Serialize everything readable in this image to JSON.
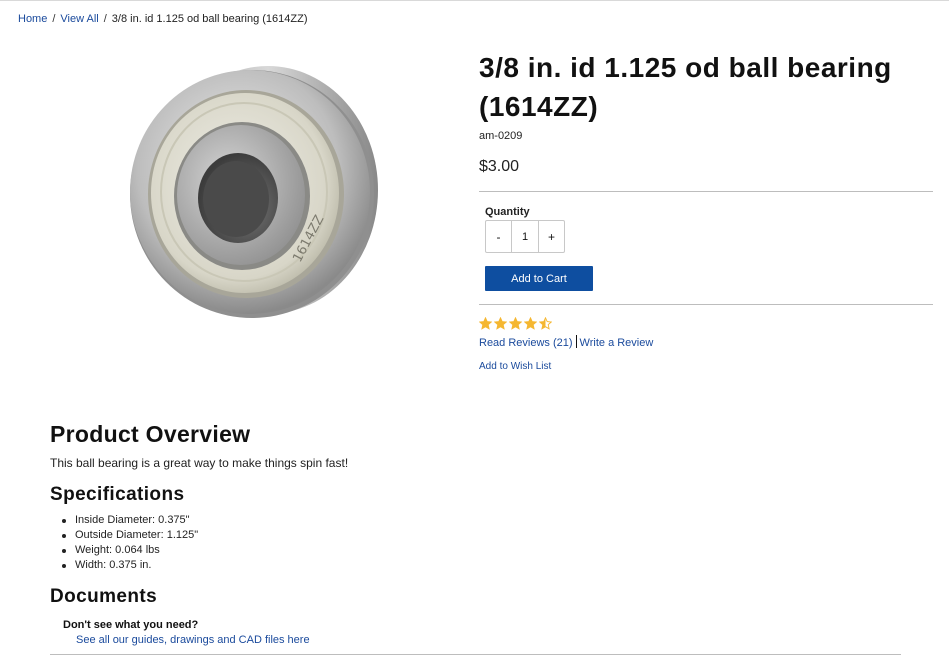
{
  "breadcrumb": {
    "home": "Home",
    "view_all": "View All",
    "current": "3/8 in. id 1.125 od ball bearing (1614ZZ)",
    "separator": "/"
  },
  "product": {
    "title": "3/8 in. id 1.125 od ball bearing (1614ZZ)",
    "sku": "am-0209",
    "price": "$3.00",
    "image_marking": "1614ZZ"
  },
  "purchase": {
    "quantity_label": "Quantity",
    "decrement": "-",
    "quantity_value": "1",
    "increment": "+",
    "add_to_cart": "Add to Cart"
  },
  "rating": {
    "value": 4.5,
    "max": 5,
    "star_color": "#f5b731",
    "read_reviews": "Read Reviews (21)",
    "write_review": "Write a Review",
    "wish_list": "Add to Wish List"
  },
  "overview": {
    "heading": "Product Overview",
    "text": "This ball bearing is a great way to make things spin fast!"
  },
  "specifications": {
    "heading": "Specifications",
    "items": [
      "Inside Diameter: 0.375\"",
      "Outside Diameter: 1.125\"",
      "Weight: 0.064 lbs",
      "Width: 0.375 in."
    ]
  },
  "documents": {
    "heading": "Documents",
    "question": "Don't see what you need?",
    "link": "See all our guides, drawings and CAD files here"
  },
  "colors": {
    "link": "#1a4a9c",
    "button": "#0e4ea0",
    "star": "#f5b731"
  }
}
